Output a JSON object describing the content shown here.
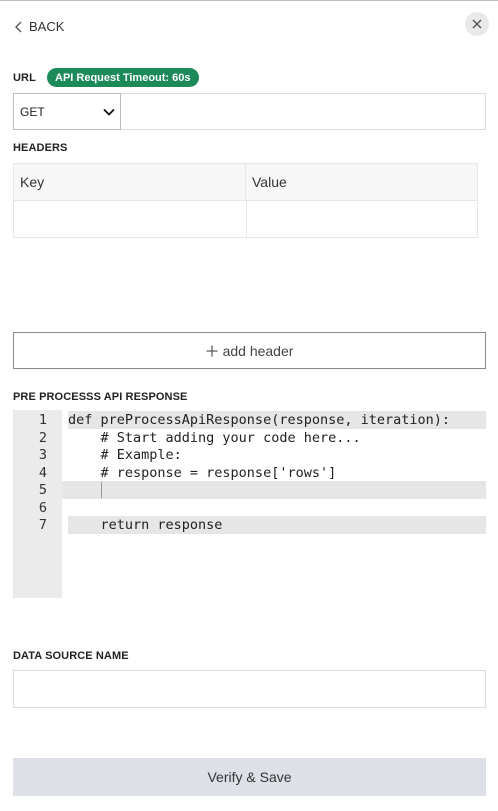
{
  "nav": {
    "back_label": "BACK"
  },
  "url_section": {
    "label": "URL",
    "badge": "API Request Timeout: 60s",
    "method": "GET",
    "url_value": ""
  },
  "headers_section": {
    "label": "HEADERS",
    "columns": [
      "Key",
      "Value"
    ],
    "add_label": "add header"
  },
  "preprocess": {
    "label": "PRE PROCESSS API RESPONSE",
    "lines": [
      "def preProcessApiResponse(response, iteration):",
      "    # Start adding your code here...",
      "    # Example:",
      "    # response = response['rows']",
      "    ",
      "",
      "    return response"
    ],
    "line_numbers": [
      "1",
      "2",
      "3",
      "4",
      "5",
      "6",
      "7"
    ]
  },
  "data_source": {
    "label": "DATA SOURCE NAME",
    "value": ""
  },
  "actions": {
    "verify_label": "Verify & Save"
  },
  "colors": {
    "badge": "#1d8a5a",
    "verify_bg": "#dde1e7"
  },
  "icons": {
    "back": "chevron-left-icon",
    "close": "close-icon",
    "dropdown": "chevron-down-icon",
    "add": "plus-icon"
  }
}
